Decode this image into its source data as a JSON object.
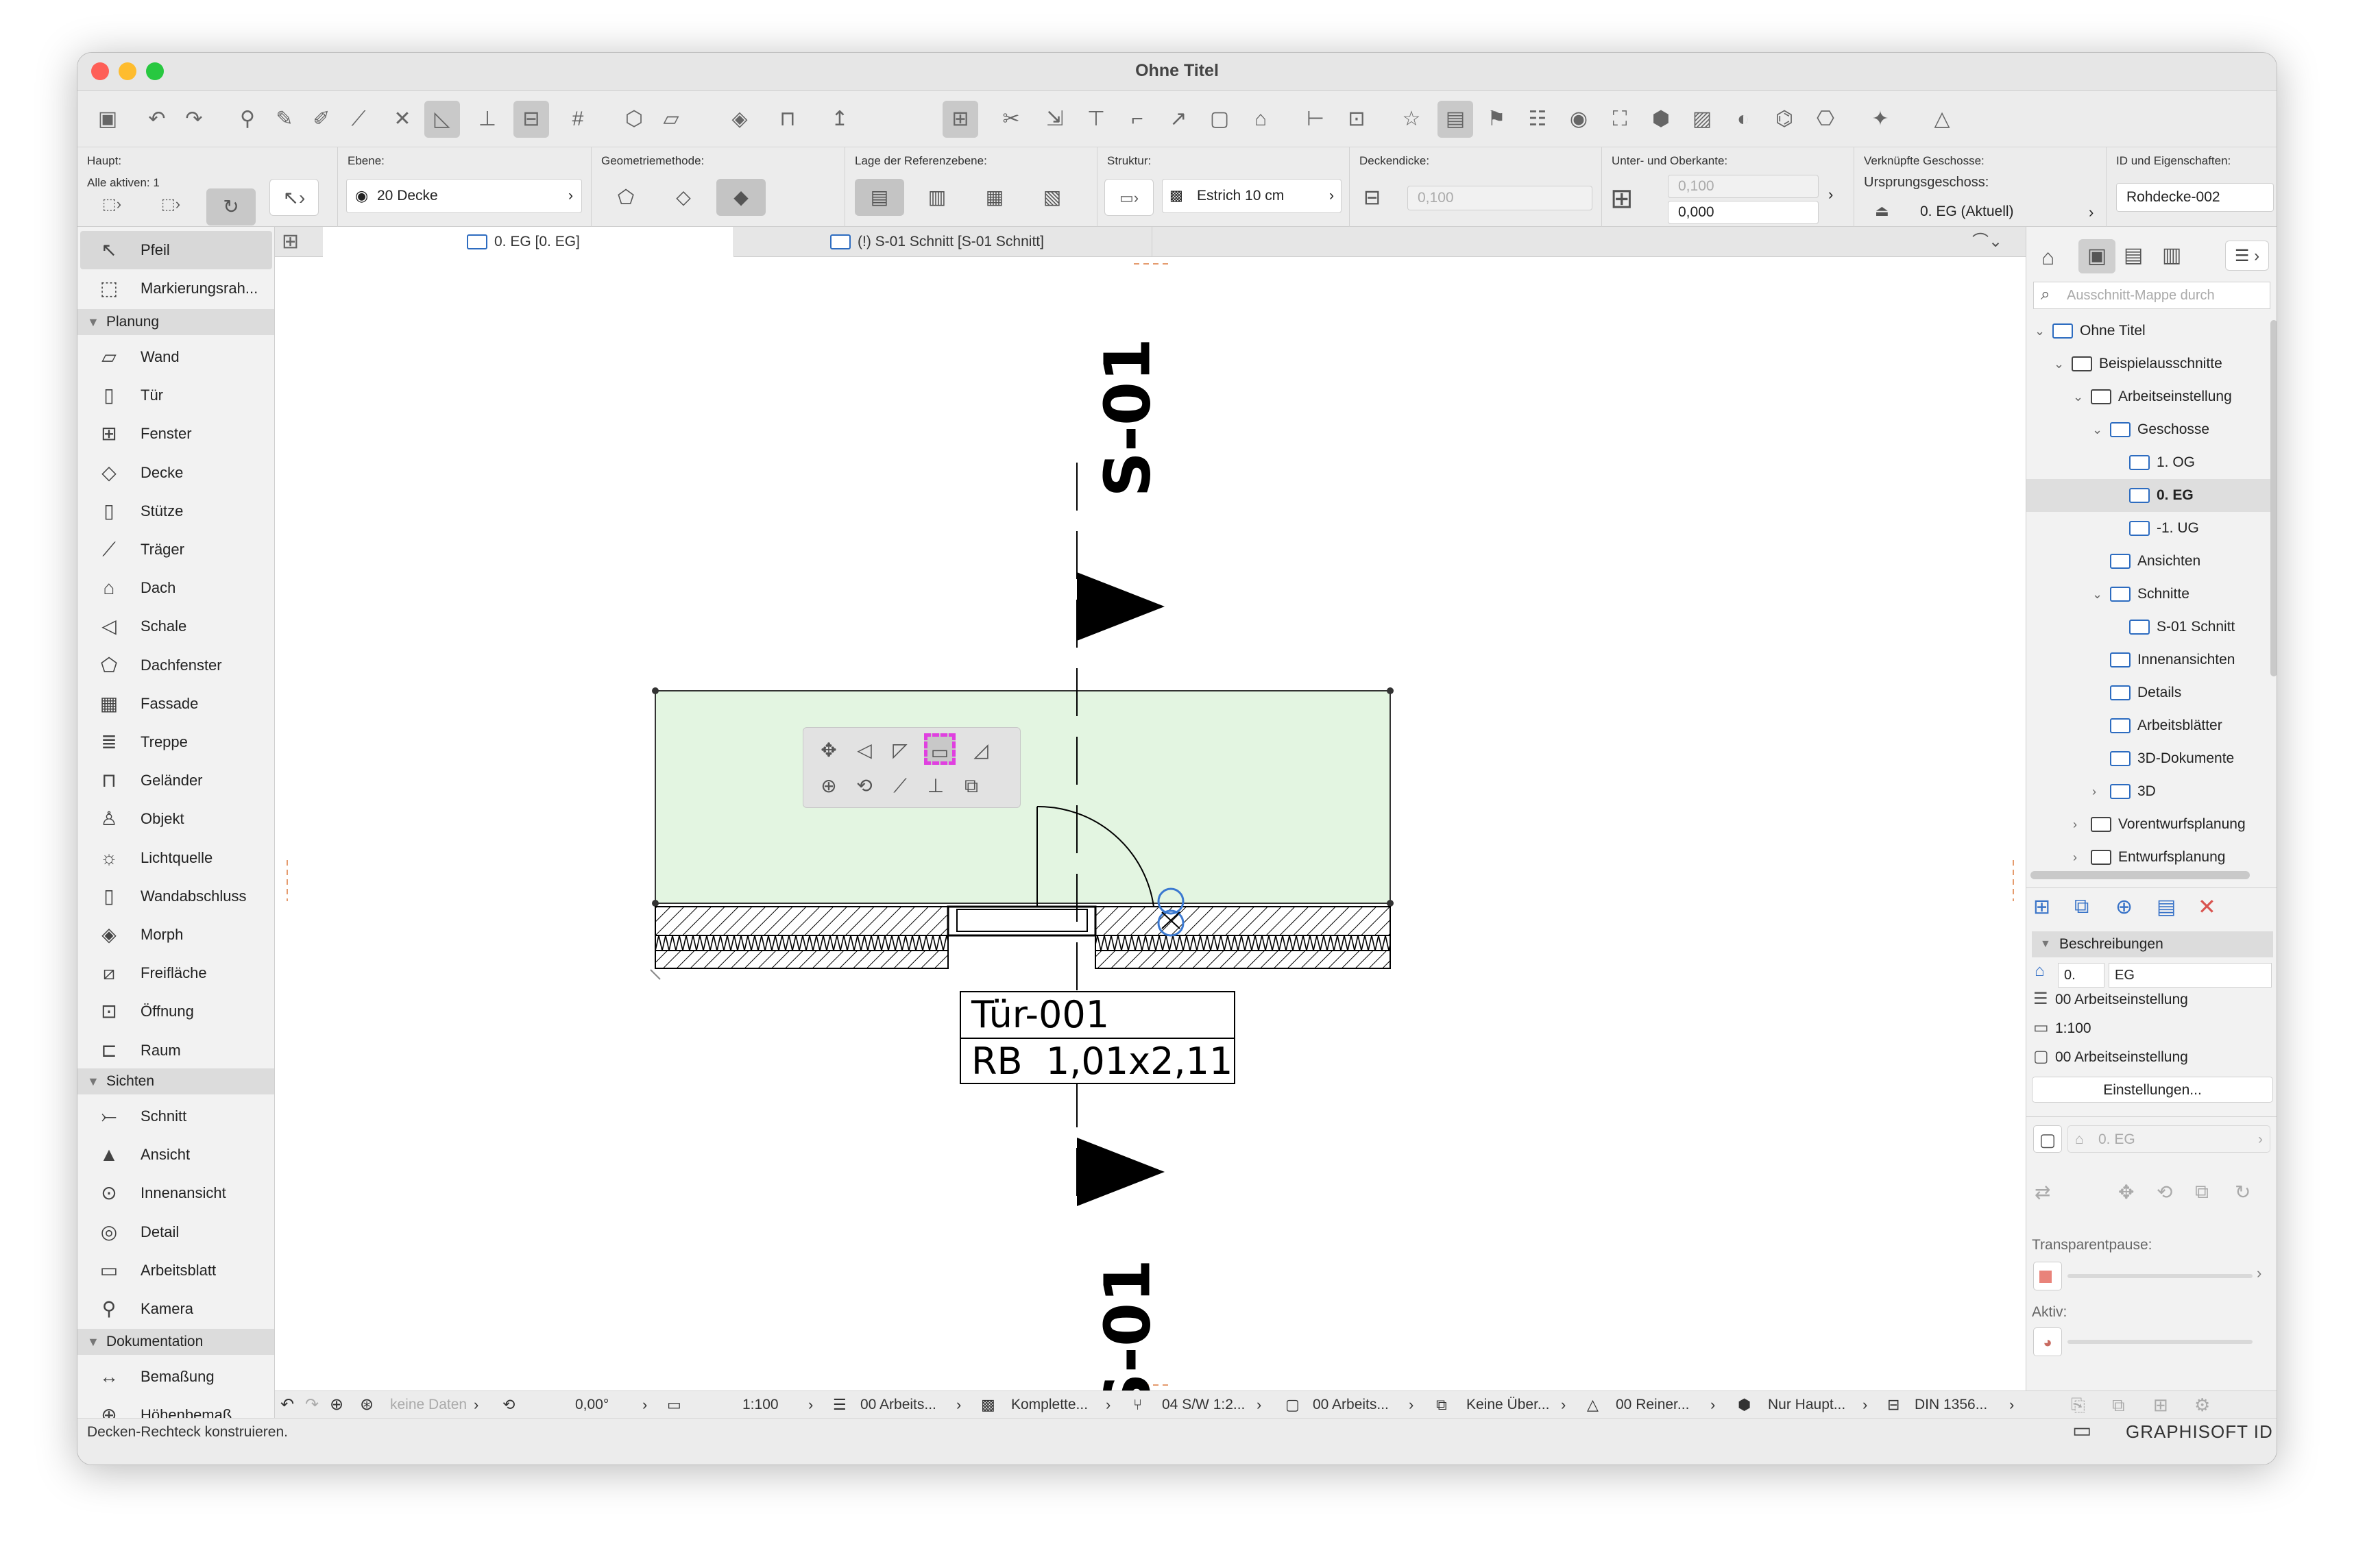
{
  "window": {
    "title": "Ohne Titel"
  },
  "infobox": {
    "haupt": {
      "label": "Haupt:",
      "sub": "Alle aktiven: 1"
    },
    "ebene": {
      "label": "Ebene:",
      "value": "20 Decke"
    },
    "geometrie": {
      "label": "Geometriemethode:"
    },
    "referenzebene": {
      "label": "Lage der Referenzebene:"
    },
    "struktur": {
      "label": "Struktur:",
      "value": "Estrich 10 cm"
    },
    "deckendicke": {
      "label": "Deckendicke:",
      "value": "0,100"
    },
    "unter_ober": {
      "label": "Unter- und Oberkante:",
      "top": "0,100",
      "bottom": "0,000"
    },
    "geschosse": {
      "label": "Verknüpfte Geschosse:",
      "sub": "Ursprungsgeschoss:",
      "value": "0. EG (Aktuell)"
    },
    "id": {
      "label": "ID und Eigenschaften:",
      "value": "Rohdecke-002"
    }
  },
  "toolbox": {
    "arrow": "Pfeil",
    "marquee": "Markierungsrah...",
    "groups": {
      "planung": "Planung",
      "sichten": "Sichten",
      "dokumentation": "Dokumentation"
    },
    "planung": [
      "Wand",
      "Tür",
      "Fenster",
      "Decke",
      "Stütze",
      "Träger",
      "Dach",
      "Schale",
      "Dachfenster",
      "Fassade",
      "Treppe",
      "Geländer",
      "Objekt",
      "Lichtquelle",
      "Wandabschluss",
      "Morph",
      "Freifläche",
      "Öffnung",
      "Raum"
    ],
    "sichten": [
      "Schnitt",
      "Ansicht",
      "Innenansicht",
      "Detail",
      "Arbeitsblatt",
      "Kamera"
    ],
    "dokumentation": [
      "Bemaßung",
      "Höhenbemaß..."
    ]
  },
  "tabs": [
    {
      "label": "0. EG [0. EG]"
    },
    {
      "label": "(!) S-01 Schnitt [S-01 Schnitt]"
    }
  ],
  "drawing": {
    "section_label": "S-01",
    "door_id": "Tür-001",
    "door_size": "RB  1,01x2,11"
  },
  "navigator": {
    "search_placeholder": "Ausschnitt-Mappe durch",
    "tree": [
      {
        "label": "Ohne Titel",
        "level": 0,
        "expanded": true
      },
      {
        "label": "Beispielausschnitte",
        "level": 1,
        "expanded": true
      },
      {
        "label": "Arbeitseinstellung",
        "level": 2,
        "expanded": true
      },
      {
        "label": "Geschosse",
        "level": 3,
        "expanded": true
      },
      {
        "label": "1. OG",
        "level": 4
      },
      {
        "label": "0. EG",
        "level": 4,
        "selected": true
      },
      {
        "label": "-1. UG",
        "level": 4
      },
      {
        "label": "Ansichten",
        "level": 3
      },
      {
        "label": "Schnitte",
        "level": 3,
        "expanded": true
      },
      {
        "label": "S-01 Schnitt",
        "level": 4
      },
      {
        "label": "Innenansichten",
        "level": 3
      },
      {
        "label": "Details",
        "level": 3
      },
      {
        "label": "Arbeitsblätter",
        "level": 3
      },
      {
        "label": "3D-Dokumente",
        "level": 3
      },
      {
        "label": "3D",
        "level": 3,
        "collapsed": true
      },
      {
        "label": "Vorentwurfsplanung",
        "level": 2,
        "collapsed": true
      },
      {
        "label": "Entwurfsplanung",
        "level": 2,
        "collapsed": true
      }
    ],
    "props": {
      "header": "Beschreibungen",
      "num": "0.",
      "name": "EG",
      "layer_combo": "00 Arbeitseinstellung",
      "scale": "1:100",
      "model": "00 Arbeitseinstellung",
      "settings_btn": "Einstellungen...",
      "trace_ref": "0. EG",
      "trace_label": "Transparentpause:",
      "active_label": "Aktiv:"
    }
  },
  "statusbar": {
    "no_data": "keine Daten",
    "angle": "0,00°",
    "scale": "1:100",
    "layers": "00 Arbeits...",
    "structure": "Komplette...",
    "pen": "04 S/W 1:2...",
    "model": "00 Arbeits...",
    "override": "Keine Über...",
    "renovation": "00 Reiner...",
    "structure2": "Nur Haupt...",
    "dimension": "DIN 1356..."
  },
  "hint": {
    "message": "Decken-Rechteck konstruieren.",
    "brand": "GRAPHISOFT ID"
  },
  "colors": {
    "slab_fill": "#e3f5e1",
    "accent": "#2d6cc0",
    "highlight": "#e040e0"
  }
}
